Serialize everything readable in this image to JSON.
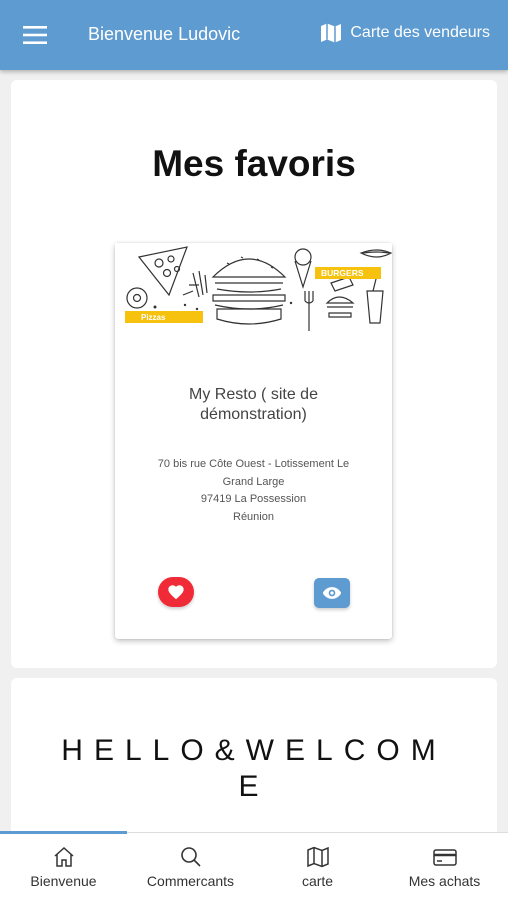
{
  "header": {
    "menu_icon": "hamburger-icon",
    "title": "Bienvenue Ludovic",
    "map_link_label": "Carte des vendeurs",
    "map_icon": "map-icon",
    "color": "#5e9bd0"
  },
  "favorites": {
    "heading": "Mes favoris",
    "cards": [
      {
        "image_labels": {
          "pizzas": "Pizzas",
          "burgers": "BURGERS"
        },
        "name": "My Resto ( site de démonstration)",
        "address_lines": [
          "70 bis rue Côte Ouest - Lotissement Le Grand Large",
          "97419 La Possession",
          "Réunion"
        ],
        "favorite_icon": "heart-icon",
        "favorite_color": "#f02a36",
        "view_icon": "eye-icon"
      }
    ]
  },
  "welcome": {
    "text": "HELLO&WELCOME"
  },
  "tabbar": {
    "active_index": 0,
    "tabs": [
      {
        "label": "Bienvenue",
        "icon": "home-icon"
      },
      {
        "label": "Commercants",
        "icon": "search-icon"
      },
      {
        "label": "carte",
        "icon": "map-icon"
      },
      {
        "label": "Mes achats",
        "icon": "card-icon"
      }
    ]
  }
}
